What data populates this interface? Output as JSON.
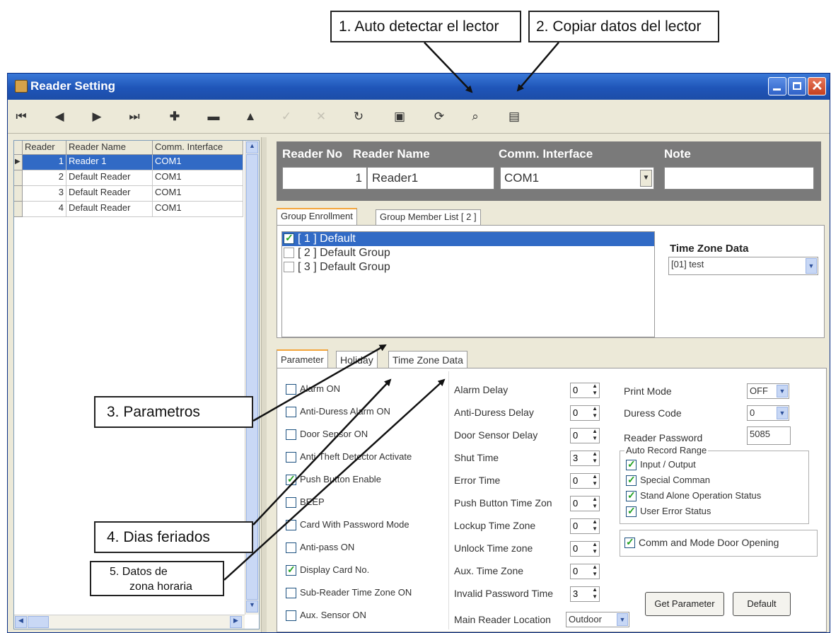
{
  "callouts": {
    "c1": "1. Auto detectar el lector",
    "c2": "2. Copiar datos del lector",
    "c3": "3. Parametros",
    "c4": "4. Dias feriados",
    "c5_line1": "5. Datos de",
    "c5_line2": "zona horaria"
  },
  "window": {
    "title": "Reader Setting"
  },
  "grid": {
    "headers": [
      "Reader",
      "Reader Name",
      "Comm. Interface"
    ],
    "rows": [
      {
        "no": "1",
        "name": "Reader 1",
        "iface": "COM1"
      },
      {
        "no": "2",
        "name": "Default Reader",
        "iface": "COM1"
      },
      {
        "no": "3",
        "name": "Default Reader",
        "iface": "COM1"
      },
      {
        "no": "4",
        "name": "Default Reader",
        "iface": "COM1"
      }
    ]
  },
  "header": {
    "reader_no_label": "Reader No",
    "reader_name_label": "Reader Name",
    "comm_label": "Comm. Interface",
    "note_label": "Note",
    "reader_no_value": "1",
    "reader_name_value": "Reader1",
    "comm_value": "COM1",
    "note_value": ""
  },
  "group_tabs": [
    "Group Enrollment",
    "Group Member List [ 2 ]"
  ],
  "groups": [
    {
      "label": "[  1 ]  Default",
      "checked": true
    },
    {
      "label": "[  2 ]  Default Group",
      "checked": false
    },
    {
      "label": "[  3 ]  Default Group",
      "checked": false
    }
  ],
  "time_zone": {
    "label": "Time Zone Data",
    "value": "[01] test"
  },
  "param_tabs": [
    "Parameter",
    "Holiday",
    "Time Zone Data"
  ],
  "checkboxes": [
    {
      "label": "Alarm ON",
      "checked": false
    },
    {
      "label": "Anti-Duress Alarm ON",
      "checked": false
    },
    {
      "label": "Door Sensor ON",
      "checked": false
    },
    {
      "label": "Anti-Theft Detector Activate",
      "checked": false
    },
    {
      "label": "Push Button Enable",
      "checked": true
    },
    {
      "label": "BEEP",
      "checked": false
    },
    {
      "label": "Card With Password Mode",
      "checked": false
    },
    {
      "label": "Anti-pass ON",
      "checked": false
    },
    {
      "label": "Display Card No.",
      "checked": true
    },
    {
      "label": "Sub-Reader Time Zone ON",
      "checked": false
    },
    {
      "label": "Aux. Sensor ON",
      "checked": false
    }
  ],
  "delays": [
    {
      "label": "Alarm Delay",
      "value": "0"
    },
    {
      "label": "Anti-Duress Delay",
      "value": "0"
    },
    {
      "label": "Door Sensor Delay",
      "value": "0"
    },
    {
      "label": "Shut Time",
      "value": "3"
    },
    {
      "label": "Error Time",
      "value": "0"
    },
    {
      "label": "Push Button Time Zon",
      "value": "0"
    },
    {
      "label": "Lockup Time Zone",
      "value": "0"
    },
    {
      "label": "Unlock Time zone",
      "value": "0"
    },
    {
      "label": "Aux. Time Zone",
      "value": "0"
    },
    {
      "label": "Invalid Password Time",
      "value": "3"
    }
  ],
  "main_reader": {
    "label": "Main Reader Location",
    "value": "Outdoor"
  },
  "right": {
    "print_mode_label": "Print Mode",
    "print_mode_value": "OFF",
    "duress_label": "Duress Code",
    "duress_value": "0",
    "password_label": "Reader Password",
    "password_value": "5085",
    "auto_record_label": "Auto Record Range",
    "auto_record": [
      {
        "label": "Input / Output",
        "checked": true
      },
      {
        "label": "Special Comman",
        "checked": true
      },
      {
        "label": "Stand Alone Operation Status",
        "checked": true
      },
      {
        "label": "User Error Status",
        "checked": true
      }
    ],
    "command_mode": {
      "label": "Comm and Mode Door Opening",
      "checked": true
    },
    "get_param_label": "Get Parameter",
    "default_label": "Default"
  }
}
